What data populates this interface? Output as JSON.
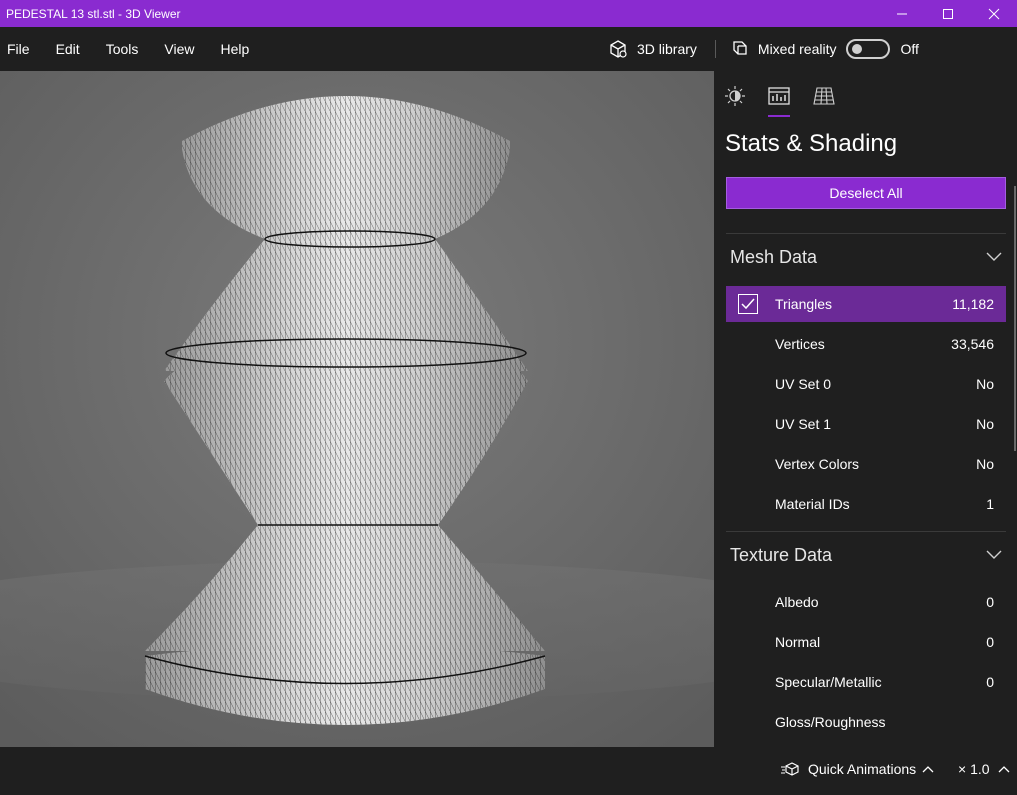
{
  "window": {
    "title": "PEDESTAL 13 stl.stl - 3D Viewer"
  },
  "menu": {
    "items": [
      "File",
      "Edit",
      "Tools",
      "View",
      "Help"
    ],
    "library_label": "3D library",
    "mixed_reality_label": "Mixed reality",
    "mixed_reality_state": "Off"
  },
  "panel": {
    "tabs": [
      "lighting-icon",
      "stats-icon",
      "grid-icon"
    ],
    "active_tab": 1,
    "title": "Stats & Shading",
    "deselect_label": "Deselect All",
    "mesh_section": {
      "title": "Mesh Data",
      "rows": [
        {
          "label": "Triangles",
          "value": "11,182",
          "checked": true
        },
        {
          "label": "Vertices",
          "value": "33,546"
        },
        {
          "label": "UV Set 0",
          "value": "No"
        },
        {
          "label": "UV Set 1",
          "value": "No"
        },
        {
          "label": "Vertex Colors",
          "value": "No"
        },
        {
          "label": "Material IDs",
          "value": "1"
        }
      ]
    },
    "texture_section": {
      "title": "Texture Data",
      "rows": [
        {
          "label": "Albedo",
          "value": "0"
        },
        {
          "label": "Normal",
          "value": "0"
        },
        {
          "label": "Specular/Metallic",
          "value": "0"
        },
        {
          "label": "Gloss/Roughness",
          "value": ""
        }
      ]
    }
  },
  "status": {
    "quick_animations_label": "Quick Animations",
    "speed_label": "× 1.0"
  },
  "colors": {
    "accent": "#8a2bd0",
    "selected_row": "#6b2a97",
    "background": "#1f1f1f"
  }
}
